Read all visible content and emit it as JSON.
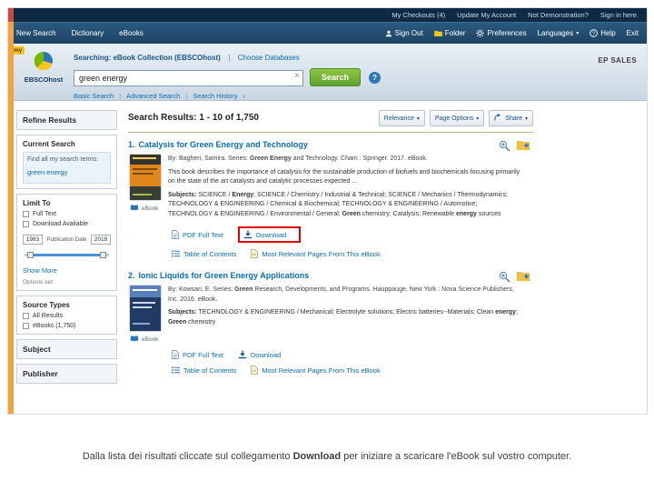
{
  "utility_bar": {
    "items": [
      "My Checkouts (4)",
      "Update My Account",
      "Not Demonstration?",
      "Sign in here."
    ]
  },
  "toolbar": {
    "left_items": [
      "New Search",
      "Dictionary",
      "eBooks"
    ],
    "sign_out": "Sign Out",
    "folder": "Folder",
    "preferences": "Preferences",
    "languages": "Languages",
    "help": "Help",
    "exit": "Exit"
  },
  "header": {
    "my_badge": "my",
    "logo_text": "EBSCOhost",
    "searching": "Searching: eBook Collection (EBSCOhost)",
    "divider": "|",
    "choose_databases": "Choose Databases",
    "search_value": "green energy",
    "search_button": "Search",
    "basic_search": "Basic Search",
    "advanced_search": "Advanced Search",
    "search_history": "Search History",
    "account_label": "EP SALES"
  },
  "sidebar": {
    "refine_title": "Refine Results",
    "current_search_title": "Current Search",
    "find_terms_label": "Find all my search terms:",
    "search_term": "green energy",
    "limit_to_title": "Limit To",
    "limit_options": [
      "Full Text",
      "Download Available"
    ],
    "date_from": "1983",
    "date_label": "Publication Date",
    "date_to": "2018",
    "show_more": "Show More",
    "options_set": "Options set",
    "source_types_title": "Source Types",
    "source_options": [
      "All Results",
      "eBooks (1,750)"
    ],
    "section_subject": "Subject",
    "section_publisher": "Publisher"
  },
  "results": {
    "header": "Search Results: 1 - 10 of 1,750",
    "relevance_button": "Relevance",
    "page_options_button": "Page Options",
    "share_button": "Share",
    "items": [
      {
        "number": "1.",
        "title": "Catalysis for Green Energy and Technology",
        "byline_segments": [
          {
            "t": "By: Bagheri, Samira. Series: "
          },
          {
            "t": "Green Energy",
            "b": true
          },
          {
            "t": " and Technology. Cham : Springer. 2017. eBook."
          }
        ],
        "description": "This book describes the importance of catalysis for the sustainable production of biofuels and biochemicals focusing primarily on the state of the art catalysts and catalytic processes expected ...",
        "subject_segments": [
          {
            "t": "Subjects: ",
            "b": true
          },
          {
            "t": "SCIENCE / "
          },
          {
            "t": "Energy",
            "b": true
          },
          {
            "t": "; SCIENCE / Chemistry / Industrial & Technical; SCIENCE / Mechanics / Thermodynamics; TECHNOLOGY & ENGINEERING / Chemical & Biochemical; TECHNOLOGY & ENGINEERING / Automotive; TECHNOLOGY & ENGINEERING / Environmental / General; "
          },
          {
            "t": "Green",
            "b": true
          },
          {
            "t": " chemistry; Catalysis; Renewable "
          },
          {
            "t": "energy",
            "b": true
          },
          {
            "t": " sources"
          }
        ],
        "format": "eBook",
        "pdf_link": "PDF Full Text",
        "download_link": "Download",
        "toc_link": "Table of Contents",
        "relevant_link": "Most Relevant Pages From This eBook"
      },
      {
        "number": "2.",
        "title": "Ionic Liquids for Green Energy Applications",
        "byline_segments": [
          {
            "t": "By: Kowsari, E. Series: "
          },
          {
            "t": "Green",
            "b": true
          },
          {
            "t": " Research, Developments, and Programs. Hauppauge, New York : Nova Science Publishers, Inc. 2016. eBook."
          }
        ],
        "subject_segments": [
          {
            "t": "Subjects: ",
            "b": true
          },
          {
            "t": "TECHNOLOGY & ENGINEERING / Mechanical; Electrolyte solutions; Electric batteries--Materials; Clean "
          },
          {
            "t": "energy",
            "b": true
          },
          {
            "t": "; "
          },
          {
            "t": "Green",
            "b": true
          },
          {
            "t": " chemistry"
          }
        ],
        "format": "eBook",
        "pdf_link": "PDF Full Text",
        "download_link": "Download",
        "toc_link": "Table of Contents",
        "relevant_link": "Most Relevant Pages From This eBook"
      }
    ]
  },
  "caption_segments": [
    {
      "t": "Dalla lista dei risultati cliccate sul collegamento "
    },
    {
      "t": "Download",
      "b": true
    },
    {
      "t": " per iniziare a scaricare l'eBook sul vostro computer."
    }
  ],
  "icons": {
    "caret_down": "▾",
    "caret_right": "›",
    "clear_x": "×",
    "help_q": "?"
  },
  "colors": {
    "nav_navy": "#0e2a45",
    "toolbar_blue": "#1d4264",
    "link_blue": "#0a6cb5",
    "search_green": "#76b043",
    "highlight_red": "#e10000",
    "strip_orange": "#f2a33c"
  }
}
